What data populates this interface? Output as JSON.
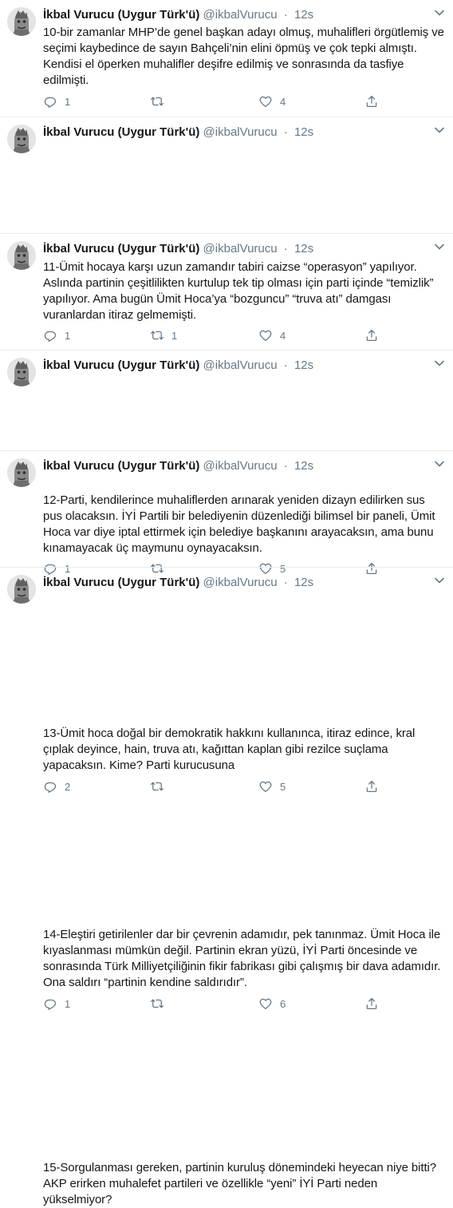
{
  "author": {
    "name": "İkbal Vurucu (Uygur Türk'ü)",
    "handle": "@ikbalVurucu",
    "separator": "·",
    "time": "12s"
  },
  "colors": {
    "text": "#14171a",
    "secondary": "#657786",
    "divider": "#e6ecf0"
  },
  "icons": {
    "reply": "reply-icon",
    "retweet": "retweet-icon",
    "like": "like-icon",
    "share": "share-icon",
    "more": "chevron-down-icon"
  },
  "tweets": [
    {
      "text": "10-bir zamanlar MHP’de genel başkan adayı olmuş, muhalifleri örgütlemiş ve seçimi kaybedince de sayın Bahçeli’nin elini öpmüş ve çok tepki almıştı. Kendisi el öperken muhalifler deşifre edilmiş ve sonrasında da tasfiye edilmişti.",
      "replies": "1",
      "retweets": "",
      "likes": "4"
    },
    {
      "text": "11-Ümit hocaya karşı uzun zamandır tabiri caizse “operasyon” yapılıyor. Aslında partinin çeşitlilikten kurtulup tek tip olması için parti içinde “temizlik” yapılıyor. Ama bugün Ümit Hoca’ya “bozguncu” “truva atı” damgası vuranlardan itiraz gelmemişti.",
      "replies": "1",
      "retweets": "1",
      "likes": "4"
    },
    {
      "text": "12-Parti, kendilerince muhaliflerden arınarak yeniden dizayn edilirken sus pus olacaksın. İYİ Partili bir belediyenin düzenlediği bilimsel bir paneli, Ümit Hoca var diye iptal ettirmek için belediye başkanını arayacaksın, ama bunu kınamayacak üç maymunu oynayacaksın.",
      "replies": "1",
      "retweets": "",
      "likes": "5"
    },
    {
      "text": "13-Ümit hoca doğal bir demokratik hakkını kullanınca, itiraz edince, kral çıplak deyince, hain, truva atı, kağıttan kaplan gibi rezilce suçlama yapacaksın. Kime? Parti kurucusuna",
      "replies": "2",
      "retweets": "",
      "likes": "5"
    },
    {
      "text": "14-Eleştiri getirilenler dar bir çevrenin adamıdır, pek tanınmaz. Ümit Hoca ile kıyaslanması mümkün değil. Partinin ekran yüzü, İYİ Parti öncesinde ve sonrasında Türk Milliyetçiliğinin fikir fabrikası gibi çalışmış bir dava adamıdır. Ona saldırı “partinin kendine saldırıdır”.",
      "replies": "1",
      "retweets": "",
      "likes": "6"
    },
    {
      "text": "15-Sorgulanması gereken, partinin kuruluş dönemindeki heyecan niye bitti? AKP erirken muhalefet partileri ve özellikle “yeni” İYİ Parti neden yükselmiyor?",
      "replies": "",
      "retweets": "",
      "likes": ""
    }
  ]
}
